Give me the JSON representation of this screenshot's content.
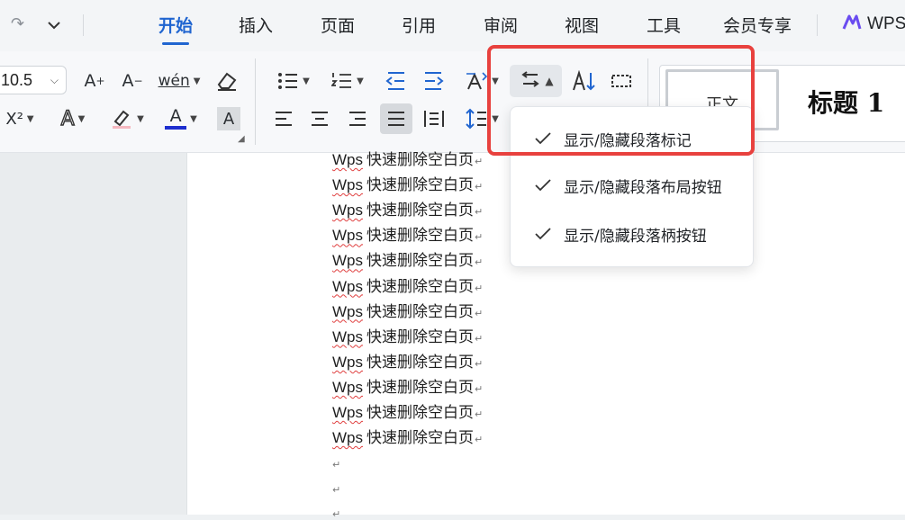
{
  "tabs": [
    {
      "label": "开始",
      "active": true
    },
    {
      "label": "插入"
    },
    {
      "label": "页面"
    },
    {
      "label": "引用"
    },
    {
      "label": "审阅"
    },
    {
      "label": "视图"
    },
    {
      "label": "工具"
    },
    {
      "label": "会员专享"
    }
  ],
  "brand": {
    "label": "WPS"
  },
  "ribbon": {
    "font_size": "10.5",
    "style_normal": "正文",
    "style_heading1": "标题 1",
    "grow_font": "A",
    "shrink_font": "A",
    "phonetic": "wén",
    "superscript": "X²",
    "text_effect": "A",
    "font_color": "A",
    "char_shading": "A"
  },
  "menu": {
    "items": [
      {
        "label": "显示/隐藏段落标记",
        "checked": true
      },
      {
        "label": "显示/隐藏段落布局按钮",
        "checked": true
      },
      {
        "label": "显示/隐藏段落柄按钮",
        "checked": true
      }
    ]
  },
  "document": {
    "line_word": "Wps",
    "line_text": "快速删除空白页",
    "paragraph_mark": "↵",
    "line_count": 12
  },
  "colors": {
    "accent": "#2065d0",
    "highlight": "#e8413e",
    "font_color_bar": "#1d2ecf"
  }
}
